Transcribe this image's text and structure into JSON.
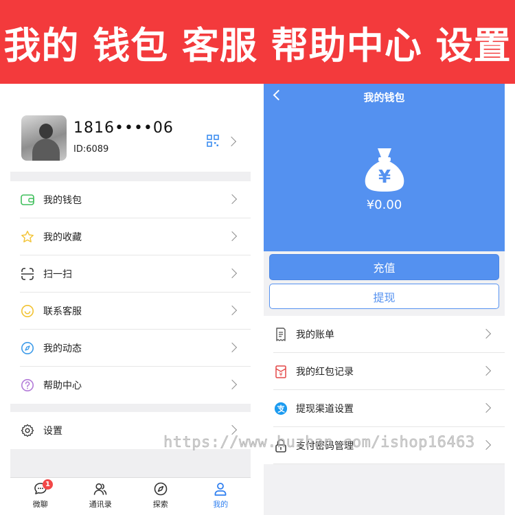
{
  "banner": {
    "text": "我的 钱包 客服 帮助中心 设置"
  },
  "colors": {
    "banner_red": "#f33a3c",
    "wallet_blue": "#5491f0",
    "tab_active_blue": "#2f7ff0",
    "badge_red": "#f24747"
  },
  "profile": {
    "name": "1816••••06",
    "id": "ID:6089",
    "qr_icon": "qr-code-icon"
  },
  "menu": {
    "items": [
      {
        "label": "我的钱包",
        "icon": "wallet-icon"
      },
      {
        "label": "我的收藏",
        "icon": "star-icon"
      },
      {
        "label": "扫一扫",
        "icon": "scan-icon"
      },
      {
        "label": "联系客服",
        "icon": "customer-service-icon"
      },
      {
        "label": "我的动态",
        "icon": "compass-icon"
      },
      {
        "label": "帮助中心",
        "icon": "help-icon"
      }
    ],
    "settings": {
      "label": "设置",
      "icon": "gear-icon"
    }
  },
  "tabbar": {
    "tabs": [
      {
        "label": "微聊",
        "icon": "chat-icon",
        "badge": "1"
      },
      {
        "label": "通讯录",
        "icon": "contacts-icon"
      },
      {
        "label": "探索",
        "icon": "explore-icon"
      },
      {
        "label": "我的",
        "icon": "user-icon",
        "active": true
      }
    ]
  },
  "wallet": {
    "title": "我的钱包",
    "balance": "¥0.00",
    "recharge_label": "充值",
    "withdraw_label": "提现",
    "items": [
      {
        "label": "我的账单",
        "icon": "bill-icon"
      },
      {
        "label": "我的红包记录",
        "icon": "red-packet-icon"
      },
      {
        "label": "提现渠道设置",
        "icon": "alipay-icon"
      },
      {
        "label": "支付密码管理",
        "icon": "lock-icon"
      }
    ]
  },
  "watermark": {
    "text": "https://www.huzhan.com/ishop16463"
  }
}
